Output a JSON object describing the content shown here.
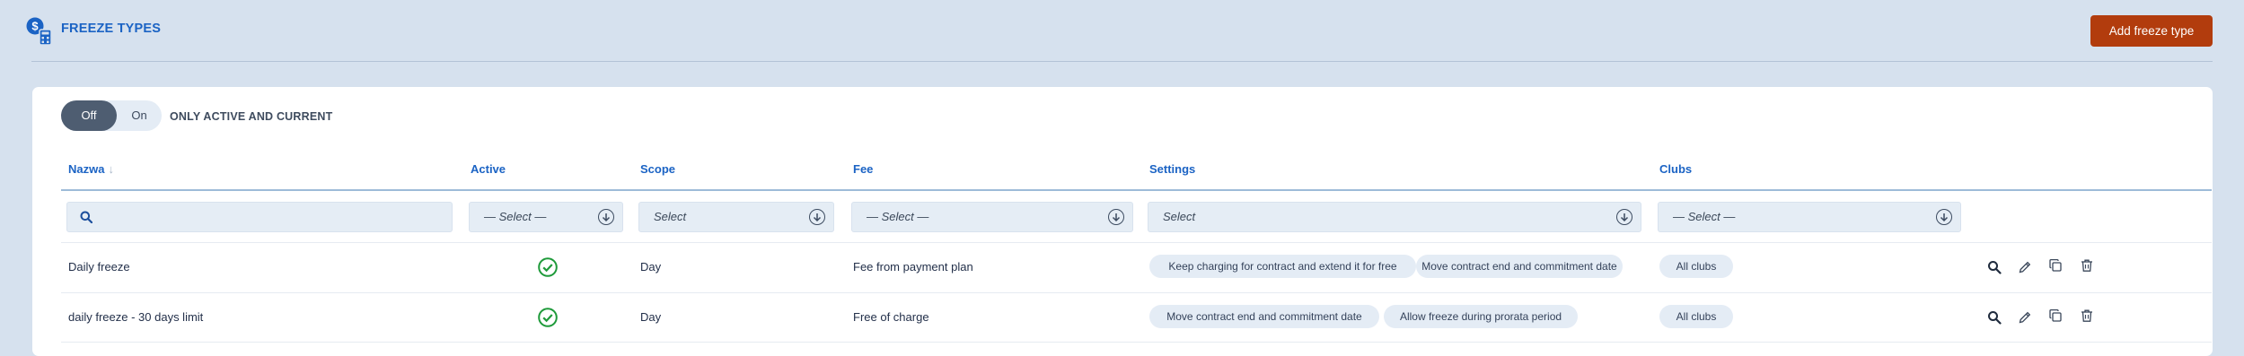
{
  "page": {
    "title": "FREEZE TYPES",
    "add_button": "Add freeze type"
  },
  "toggle": {
    "off_label": "Off",
    "on_label": "On",
    "label": "ONLY ACTIVE AND CURRENT",
    "active": "Off"
  },
  "columns": [
    "Nazwa",
    "Active",
    "Scope",
    "Fee",
    "Settings",
    "Clubs"
  ],
  "filters": {
    "name_search": "",
    "active": "— Select —",
    "scope": "Select",
    "fee": "— Select —",
    "settings": "Select",
    "clubs": "— Select —"
  },
  "rows": [
    {
      "name": "Daily freeze",
      "active": true,
      "scope": "Day",
      "fee": "Fee from payment plan",
      "settings": [
        "Keep charging for contract and extend it for free",
        "Move contract end and commitment date"
      ],
      "clubs": [
        "All clubs"
      ]
    },
    {
      "name": "daily freeze - 30 days limit",
      "active": true,
      "scope": "Day",
      "fee": "Free of charge",
      "settings": [
        "Move contract end and commitment date",
        "Allow freeze during prorata period"
      ],
      "clubs": [
        "All clubs"
      ]
    }
  ],
  "colors": {
    "accent": "#1b63c4",
    "primary_button": "#b23c0d",
    "check": "#1e9a3a"
  },
  "icons": {
    "row_actions": [
      "search-icon",
      "edit-icon",
      "copy-icon",
      "delete-icon"
    ]
  }
}
